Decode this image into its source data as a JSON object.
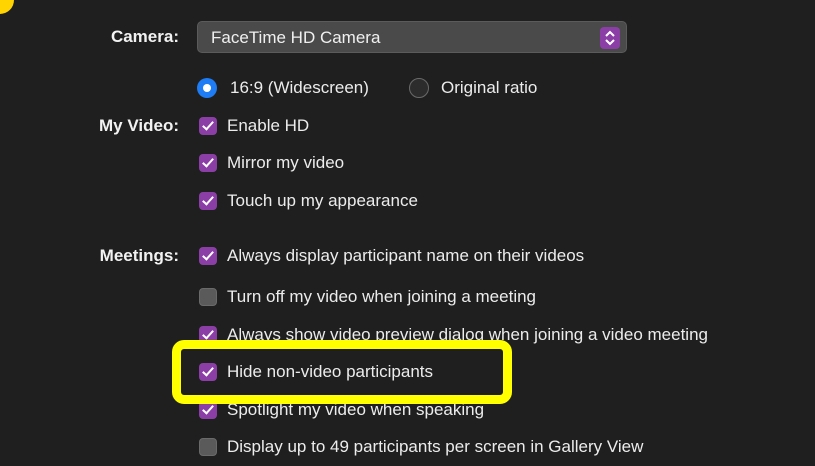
{
  "camera": {
    "label": "Camera:",
    "selected": "FaceTime HD Camera",
    "arrows_icon": "updown-chevron-icon"
  },
  "aspect": {
    "option1": "16:9 (Widescreen)",
    "option1_selected": true,
    "option2": "Original ratio",
    "option2_selected": false
  },
  "my_video": {
    "label": "My Video:",
    "items": [
      {
        "text": "Enable HD",
        "checked": true
      },
      {
        "text": "Mirror my video",
        "checked": true
      },
      {
        "text": "Touch up my appearance",
        "checked": true
      }
    ]
  },
  "meetings": {
    "label": "Meetings:",
    "items": [
      {
        "text": "Always display participant name on their videos",
        "checked": true
      },
      {
        "text": "Turn off my video when joining a meeting",
        "checked": false
      },
      {
        "text": "Always show video preview dialog when joining a video meeting",
        "checked": true
      },
      {
        "text": "Hide non-video participants",
        "checked": true
      },
      {
        "text": "Spotlight my video when speaking",
        "checked": true
      },
      {
        "text": "Display up to 49 participants per screen in Gallery View",
        "checked": false
      }
    ]
  },
  "colors": {
    "accent_purple": "#8b3fa6",
    "radio_blue": "#1e7cf5",
    "highlight_yellow": "#ffff00",
    "background": "#1f1f1f"
  }
}
